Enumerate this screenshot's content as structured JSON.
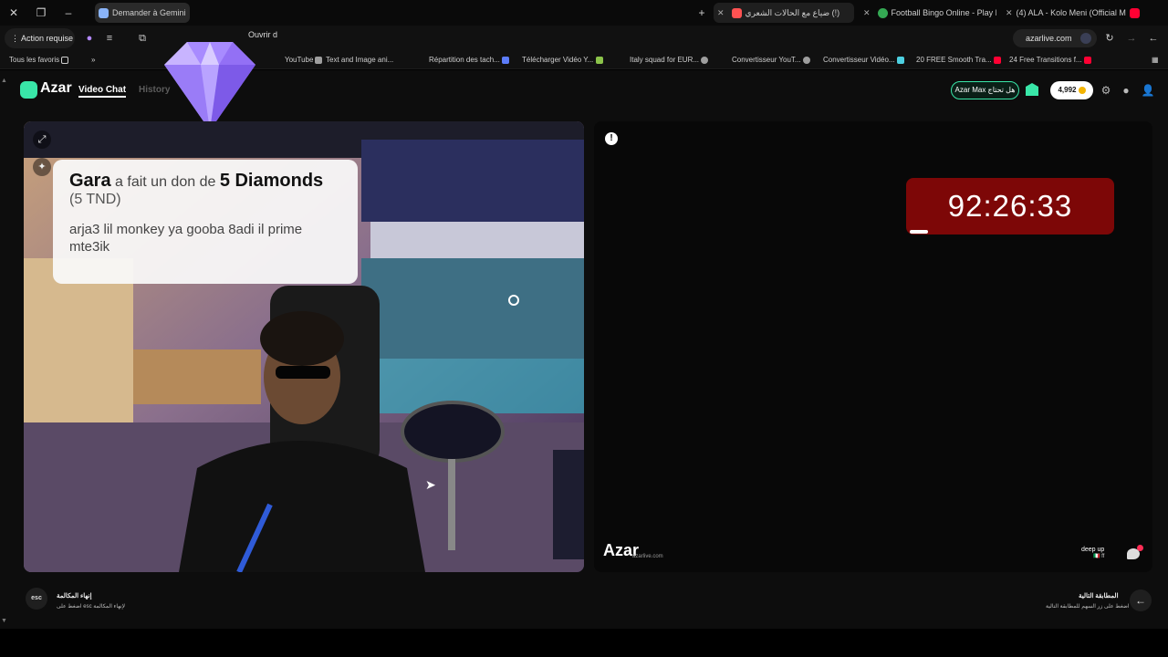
{
  "browser": {
    "tabs": [
      {
        "label": "Demander à Gemini",
        "color": "#8ab4f8"
      },
      {
        "label": "ضياع مع الحالات الشعري (!)",
        "color": "#ff5252"
      },
      {
        "label": "Football Bingo Online - Play N",
        "color": "#34a853"
      },
      {
        "label": "(4) ALA - Kolo Meni (Official M",
        "color": "#ff0033"
      }
    ],
    "new_tab": "+"
  },
  "toolbar": {
    "action_label": "Action requise",
    "open_label": "Ouvrir d",
    "address": "azarlive.com"
  },
  "bookmarks": [
    {
      "label": "Tous les favoris",
      "color": "#cfcfcf"
    },
    {
      "label": "YouTube",
      "color": "#ff0033"
    },
    {
      "label": "Text and Image ani...",
      "color": "#ff0033"
    },
    {
      "label": "Répartition des tach...",
      "color": "#5c7cfa"
    },
    {
      "label": "Télécharger Vidéo Y...",
      "color": "#8bc34a"
    },
    {
      "label": "Italy squad for EUR...",
      "color": "#9e9e9e"
    },
    {
      "label": "Convertisseur YouT...",
      "color": "#9e9e9e"
    },
    {
      "label": "Convertisseur Vidéo...",
      "color": "#4dd0e1"
    },
    {
      "label": "20 FREE Smooth Tra...",
      "color": "#ff0033"
    },
    {
      "label": "24 Free Transitions f...",
      "color": "#ff0033"
    }
  ],
  "header": {
    "logo_text": "Azar",
    "nav_video": "Video Chat",
    "nav_history": "History",
    "vip_label": "Azar Max هل تحتاج",
    "coins": "4,992"
  },
  "gift": {
    "sender": "Gara",
    "middle": "a fait un don de",
    "item": "5 Diamonds",
    "price": "(5 TND)",
    "message": "arja3 lil monkey ya gooba 8adi il prime mte3ik"
  },
  "right_panel": {
    "timer": "92:26:33",
    "progress_fraction": 0.09,
    "watermark": "Azar",
    "watermark_sub": "azarlive.com",
    "user_name": "deep up",
    "user_sub": "🇮🇹 ff"
  },
  "hints": {
    "esc_label": "esc",
    "left_title": "إنهاء المكالمة",
    "left_sub": "اضغط على esc لإنهاء المكالمة",
    "right_title": "المطابقة التالية",
    "right_sub": "اضغط على زر السهم للمطابقة التالية"
  }
}
